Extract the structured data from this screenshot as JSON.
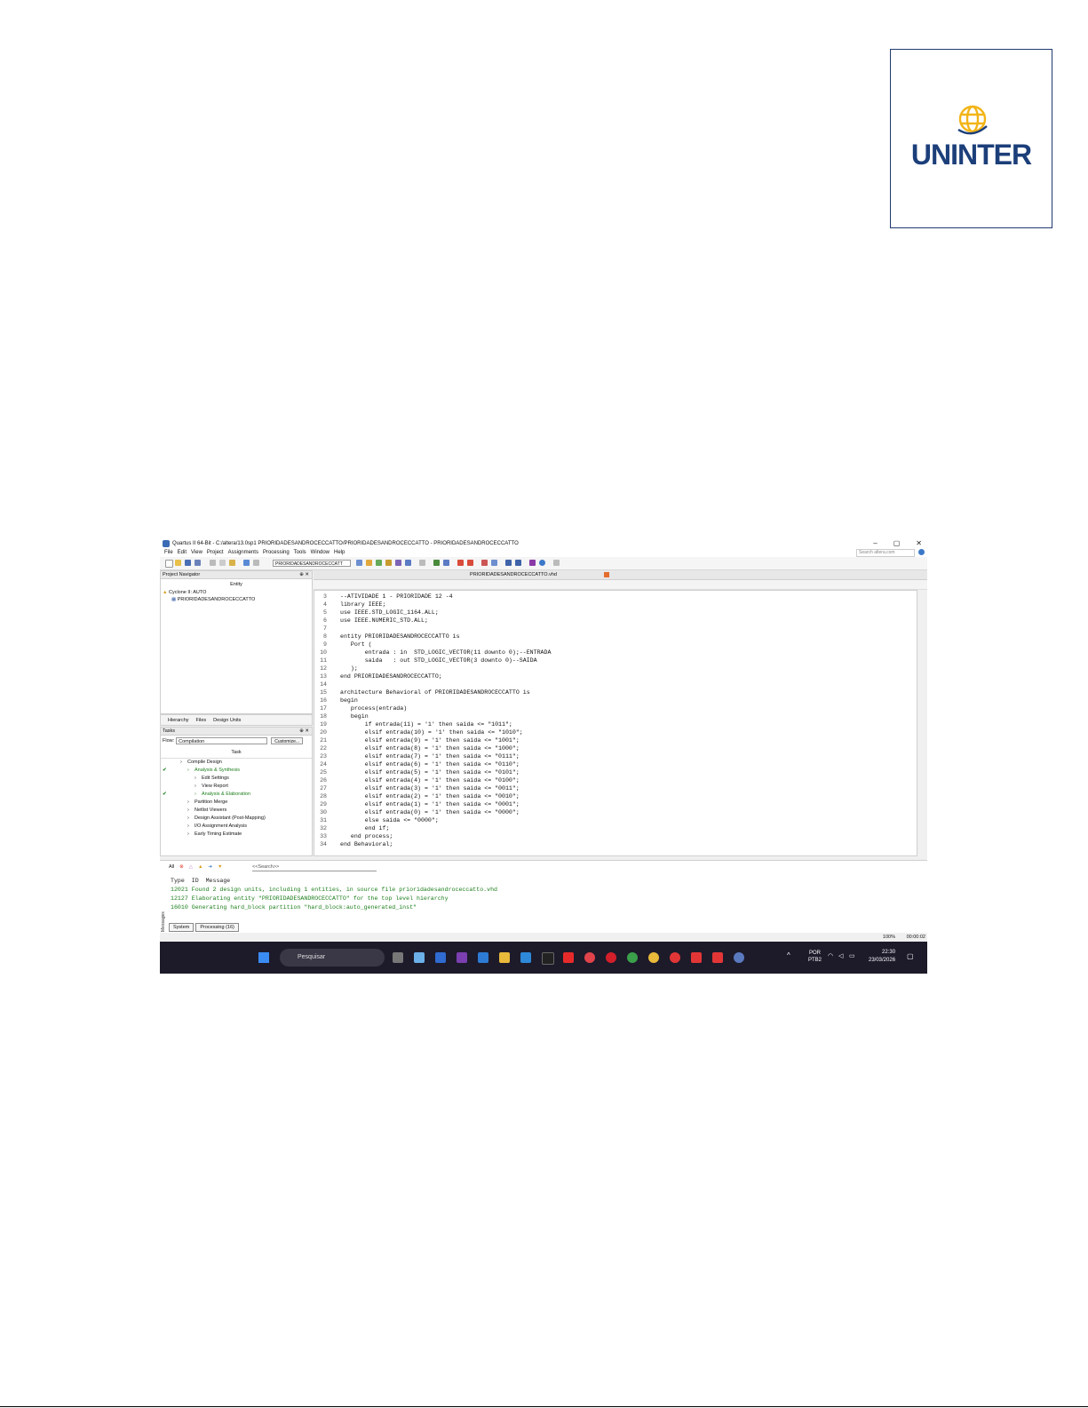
{
  "logo": {
    "text": "UNINTER"
  },
  "window": {
    "title": "Quartus II 64-Bit - C:/altera/13.0sp1 PRIORIDADESANDROCECCATTO/PRIORIDADESANDROCECCATTO - PRIORIDADESANDROCECCATTO",
    "menu": [
      "File",
      "Edit",
      "View",
      "Project",
      "Assignments",
      "Processing",
      "Tools",
      "Window",
      "Help"
    ],
    "search_placeholder": "Search altera.com",
    "toolbar_select": "PRIORIDADESANDROCECCATT"
  },
  "navigator": {
    "title": "Project Navigator",
    "column": "Entity",
    "device": "Cyclone II: AUTO",
    "entity": "PRIORIDADESANDROCECCATTO",
    "tabs": [
      "Hierarchy",
      "Files",
      "Design Units"
    ]
  },
  "tasks": {
    "title": "Tasks",
    "flow_label": "Flow:",
    "flow_value": "Compilation",
    "customize": "Customize...",
    "column": "Task",
    "items": [
      {
        "label": "Compile Design",
        "indent": 1,
        "check": false,
        "green": false
      },
      {
        "label": "Analysis & Synthesis",
        "indent": 2,
        "check": true,
        "green": true
      },
      {
        "label": "Edit Settings",
        "indent": 3,
        "check": false,
        "green": false
      },
      {
        "label": "View Report",
        "indent": 3,
        "check": false,
        "green": false
      },
      {
        "label": "Analysis & Elaboration",
        "indent": 3,
        "check": true,
        "green": true
      },
      {
        "label": "Partition Merge",
        "indent": 2,
        "check": false,
        "green": false
      },
      {
        "label": "Netlist Viewers",
        "indent": 2,
        "check": false,
        "green": false
      },
      {
        "label": "Design Assistant (Post-Mapping)",
        "indent": 2,
        "check": false,
        "green": false
      },
      {
        "label": "I/O Assignment Analysis",
        "indent": 2,
        "check": false,
        "green": false
      },
      {
        "label": "Early Timing Estimate",
        "indent": 2,
        "check": false,
        "green": false
      }
    ]
  },
  "editor": {
    "file_tab": "PRIORIDADESANDROCECCATTO.vhd",
    "lines": [
      {
        "n": "3",
        "t": "--ATIVIDADE 1 - PRIORIDADE 12 -4",
        "c": "cm"
      },
      {
        "n": "4",
        "t": "library IEEE;",
        "c": "kw"
      },
      {
        "n": "5",
        "t": "use IEEE.STD_LOGIC_1164.ALL;",
        "c": "kw"
      },
      {
        "n": "6",
        "t": "use IEEE.NUMERIC_STD.ALL;",
        "c": "kw"
      },
      {
        "n": "7",
        "t": "",
        "c": ""
      },
      {
        "n": "8",
        "t": "entity PRIORIDADESANDROCECCATTO is",
        "c": ""
      },
      {
        "n": "9",
        "t": "   Port (",
        "c": ""
      },
      {
        "n": "10",
        "t": "       entrada : in  STD_LOGIC_VECTOR(11 downto 0);--ENTRADA",
        "c": ""
      },
      {
        "n": "11",
        "t": "       saida   : out STD_LOGIC_VECTOR(3 downto 0)--SAIDA",
        "c": ""
      },
      {
        "n": "12",
        "t": "   );",
        "c": ""
      },
      {
        "n": "13",
        "t": "end PRIORIDADESANDROCECCATTO;",
        "c": ""
      },
      {
        "n": "14",
        "t": "",
        "c": ""
      },
      {
        "n": "15",
        "t": "architecture Behavioral of PRIORIDADESANDROCECCATTO is",
        "c": ""
      },
      {
        "n": "16",
        "t": "begin",
        "c": ""
      },
      {
        "n": "17",
        "t": "   process(entrada)",
        "c": ""
      },
      {
        "n": "18",
        "t": "   begin",
        "c": ""
      },
      {
        "n": "19",
        "t": "       if entrada(11) = '1' then saida <= \"1011\";",
        "c": ""
      },
      {
        "n": "20",
        "t": "       elsif entrada(10) = '1' then saida <= \"1010\";",
        "c": ""
      },
      {
        "n": "21",
        "t": "       elsif entrada(9) = '1' then saida <= \"1001\";",
        "c": ""
      },
      {
        "n": "22",
        "t": "       elsif entrada(8) = '1' then saida <= \"1000\";",
        "c": ""
      },
      {
        "n": "23",
        "t": "       elsif entrada(7) = '1' then saida <= \"0111\";",
        "c": ""
      },
      {
        "n": "24",
        "t": "       elsif entrada(6) = '1' then saida <= \"0110\";",
        "c": ""
      },
      {
        "n": "25",
        "t": "       elsif entrada(5) = '1' then saida <= \"0101\";",
        "c": ""
      },
      {
        "n": "26",
        "t": "       elsif entrada(4) = '1' then saida <= \"0100\";",
        "c": ""
      },
      {
        "n": "27",
        "t": "       elsif entrada(3) = '1' then saida <= \"0011\";",
        "c": ""
      },
      {
        "n": "28",
        "t": "       elsif entrada(2) = '1' then saida <= \"0010\";",
        "c": ""
      },
      {
        "n": "29",
        "t": "       elsif entrada(1) = '1' then saida <= \"0001\";",
        "c": ""
      },
      {
        "n": "30",
        "t": "       elsif entrada(0) = '1' then saida <= \"0000\";",
        "c": ""
      },
      {
        "n": "31",
        "t": "       else saida <= \"0000\";",
        "c": ""
      },
      {
        "n": "32",
        "t": "       end if;",
        "c": ""
      },
      {
        "n": "33",
        "t": "   end process;",
        "c": ""
      },
      {
        "n": "34",
        "t": "end Behavioral;",
        "c": ""
      }
    ]
  },
  "messages": {
    "filter_all": "All",
    "search_placeholder": "<<Search>>",
    "header": "Type  ID  Message",
    "rows": [
      "12021 Found 2 design units, including 1 entities, in source file prioridadesandroceccatto.vhd",
      "12127 Elaborating entity \"PRIORIDADESANDROCECCATTO\" for the top level hierarchy",
      "16010 Generating hard_block partition \"hard_block:auto_generated_inst\""
    ],
    "tabs": [
      "System",
      "Processing (16)"
    ],
    "side_label": "Messages"
  },
  "status": {
    "zoom": "100%",
    "elapsed": "00:00:02"
  },
  "taskbar": {
    "search": "Pesquisar",
    "lang_top": "POR",
    "lang_bottom": "PTB2",
    "time": "22:30",
    "date": "23/03/2026"
  }
}
